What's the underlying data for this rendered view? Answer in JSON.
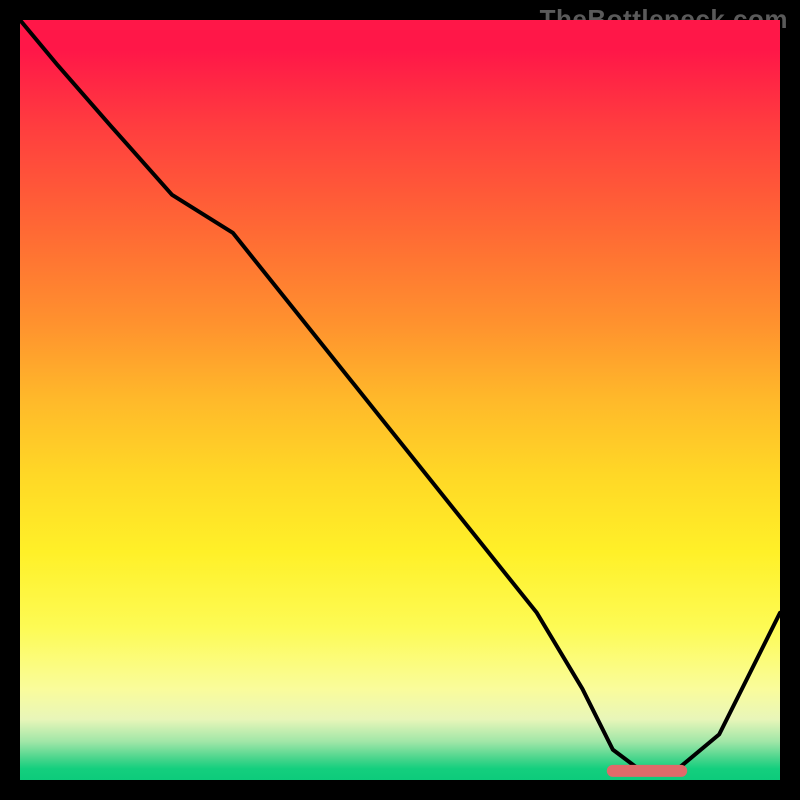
{
  "watermark": "TheBottleneck.com",
  "chart_data": {
    "type": "line",
    "title": "",
    "xlabel": "",
    "ylabel": "",
    "xlim": [
      0,
      100
    ],
    "ylim": [
      0,
      100
    ],
    "series": [
      {
        "name": "bottleneck-curve",
        "color": "#000000",
        "x": [
          0,
          5,
          12,
          20,
          28,
          36,
          44,
          52,
          60,
          68,
          74,
          78,
          82,
          86,
          92,
          96,
          100
        ],
        "y": [
          100,
          94,
          86,
          77,
          72,
          62,
          52,
          42,
          32,
          22,
          12,
          4,
          1,
          1,
          6,
          14,
          22
        ]
      }
    ],
    "marker": {
      "name": "optimal-range",
      "color": "#e06a6a",
      "thickness": 12,
      "x_start": 78,
      "x_end": 87,
      "y": 1.2
    },
    "gradient_stops": [
      {
        "pos": 0.0,
        "color": "#ff1748"
      },
      {
        "pos": 0.5,
        "color": "#ffb92a"
      },
      {
        "pos": 0.8,
        "color": "#fdfb55"
      },
      {
        "pos": 0.97,
        "color": "#4fd68e"
      },
      {
        "pos": 1.0,
        "color": "#0dcb7b"
      }
    ]
  }
}
